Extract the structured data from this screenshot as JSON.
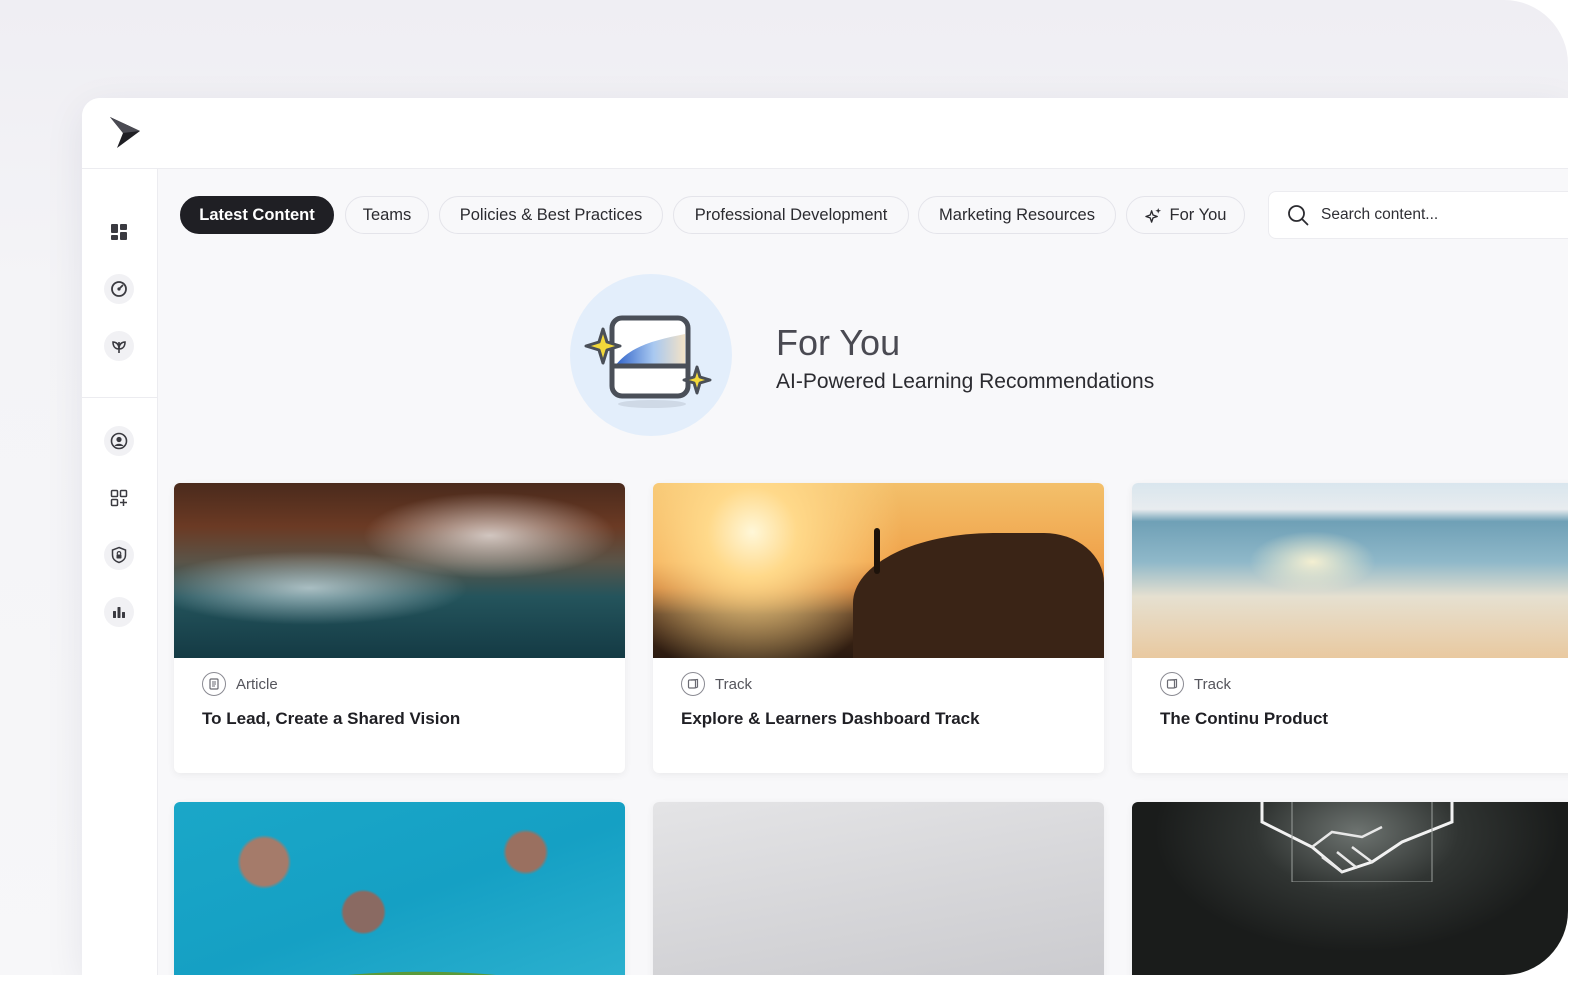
{
  "sidebar": {
    "top_items": [
      {
        "name": "dashboard",
        "icon": "grid-icon"
      },
      {
        "name": "performance",
        "icon": "gauge-icon"
      },
      {
        "name": "growth",
        "icon": "sprout-icon"
      }
    ],
    "bottom_items": [
      {
        "name": "profile",
        "icon": "user-circle-icon"
      },
      {
        "name": "apps",
        "icon": "apps-add-icon"
      },
      {
        "name": "security",
        "icon": "shield-lock-icon"
      },
      {
        "name": "analytics",
        "icon": "bar-chart-icon"
      }
    ]
  },
  "tabs": [
    {
      "label": "Latest Content",
      "active": true
    },
    {
      "label": "Teams",
      "active": false
    },
    {
      "label": "Policies & Best Practices",
      "active": false
    },
    {
      "label": "Professional Development",
      "active": false
    },
    {
      "label": "Marketing Resources",
      "active": false
    },
    {
      "label": "For You",
      "active": false,
      "icon": "sparkle-icon"
    }
  ],
  "search": {
    "placeholder": "Search content..."
  },
  "hero": {
    "title": "For You",
    "subtitle": "AI-Powered Learning Recommendations"
  },
  "cards": [
    {
      "type": "Article",
      "title": "To Lead, Create a Shared Vision",
      "image": "ocean-waves-aerial"
    },
    {
      "type": "Track",
      "title": "Explore & Learners Dashboard Track",
      "image": "sunset-person-on-rock"
    },
    {
      "type": "Track",
      "title": "The Continu Product",
      "image": "beach-shoreline"
    },
    {
      "type": "",
      "title": "",
      "image": "turquoise-reef-aerial"
    },
    {
      "type": "",
      "title": "",
      "image": "grey-gradient"
    },
    {
      "type": "",
      "title": "",
      "image": "neon-handshake"
    }
  ],
  "colors": {
    "active_tab_bg": "#1f1f24",
    "page_bg": "#f8f8fa",
    "hero_circle": "#e3eefb",
    "sparkle": "#f2d83a"
  }
}
